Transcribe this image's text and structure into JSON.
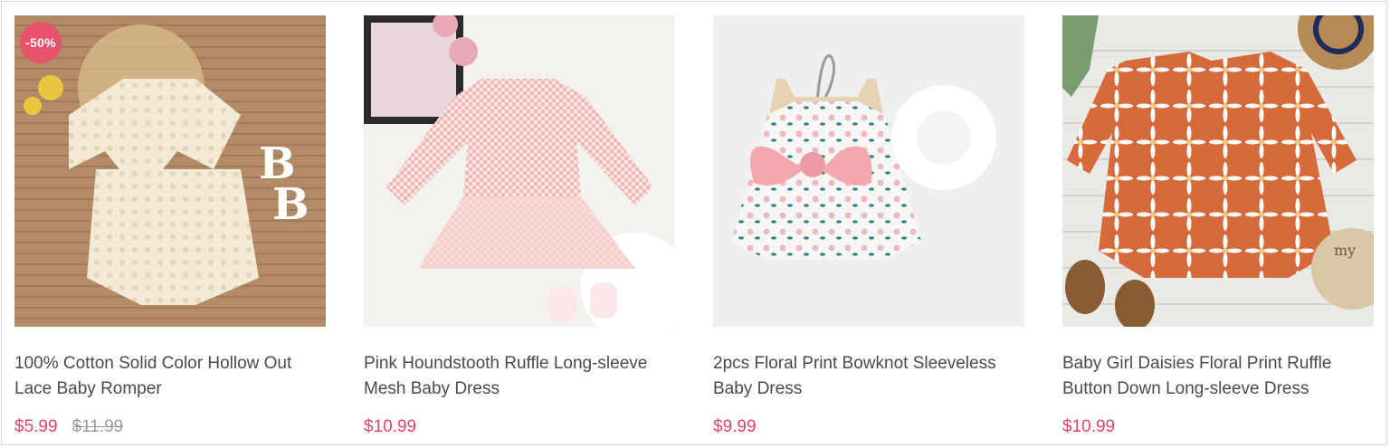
{
  "products": [
    {
      "badge": "-50%",
      "image_alt": "lace-romper-photo",
      "title_line1": "100% Cotton Solid Color Hollow Out",
      "title_line2": "Lace Baby Romper",
      "price": "$5.99",
      "original_price": "$11.99"
    },
    {
      "image_alt": "houndstooth-dress-photo",
      "title_line1": "Pink Houndstooth Ruffle Long-sleeve",
      "title_line2": "Mesh Baby Dress",
      "price": "$10.99"
    },
    {
      "image_alt": "floral-bowknot-dress-photo",
      "title_line1": "2pcs Floral Print Bowknot Sleeveless",
      "title_line2": "Baby Dress",
      "price": "$9.99"
    },
    {
      "image_alt": "daisies-ruffle-dress-photo",
      "title_line1": "Baby Girl Daisies Floral Print Ruffle",
      "title_line2": "Button Down Long-sleeve Dress",
      "price": "$10.99"
    }
  ],
  "colors": {
    "price": "#e8436a",
    "badge": "#e8526b",
    "title": "#4a4a4a",
    "old_price": "#9a9a9a"
  }
}
